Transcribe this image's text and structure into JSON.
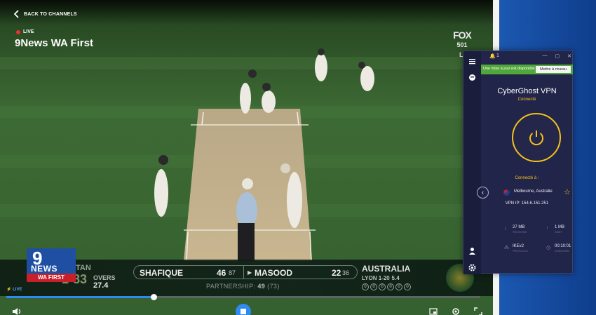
{
  "player": {
    "back_label": "BACK TO CHANNELS",
    "live_label": "LIVE",
    "channel_title": "9News WA First",
    "progress_fraction": 0.31,
    "broadcast_badge": {
      "network": "FOX",
      "sub": "501",
      "tag": "LI"
    }
  },
  "channel_logo": {
    "number": "9",
    "word": "NEWS",
    "region": "WA FIRST"
  },
  "scoreboard": {
    "team_left": "TAN",
    "team_left_score": "1-83",
    "overs_label": "OVERS",
    "overs_value": "27.4",
    "batter1": {
      "name": "SHAFIQUE",
      "runs": "46",
      "balls": "87"
    },
    "batter2": {
      "name": "MASOOD",
      "runs": "22",
      "balls": "36"
    },
    "partnership_label": "PARTNERSHIP:",
    "partnership_value": "49",
    "partnership_balls": "(73)",
    "team_right": "AUSTRALIA",
    "bowler": "LYON 1-20",
    "bowler_overs": "5.4",
    "recent_balls": [
      "0",
      "0",
      "0",
      "0",
      "0",
      "0"
    ]
  },
  "controls": {
    "live_tiny": "LIVE",
    "icons": [
      "volume-icon",
      "play-pause-icon",
      "cast-icon",
      "settings-icon",
      "fullscreen-icon"
    ]
  },
  "cyberghost": {
    "notification_count": "1",
    "update_message": "Une mise à jour est disponible !",
    "update_button": "Mettre à niveau",
    "app_title": "CyberGhost VPN",
    "status": "Connecté",
    "connected_to": "Connecté à :",
    "location": "Melbourne, Australie",
    "vpn_ip": "VPN IP: 154.6.151.251",
    "download": "27 MB",
    "download_label": "RECEIVED",
    "upload": "1 MB",
    "upload_label": "SENT",
    "protocol": "IKEv2",
    "protocol_label": "PROTOCOL",
    "duration": "00:10:01",
    "duration_label": "DURATION",
    "accent_color": "#f5c21b"
  }
}
